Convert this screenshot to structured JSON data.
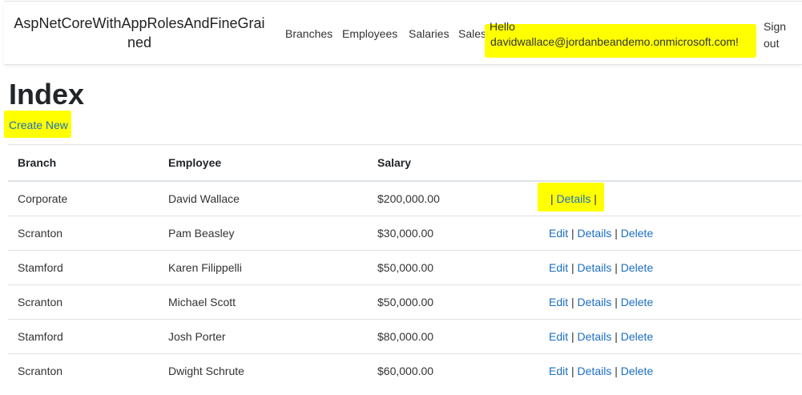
{
  "brand": "AspNetCoreWithAppRolesAndFineGrained",
  "nav": {
    "branches": "Branches",
    "employees": "Employees",
    "salaries": "Salaries",
    "sales": "Sales"
  },
  "user": {
    "hello": "Hello",
    "email": "davidwallace@jordanbeandemo.onmicrosoft.com!",
    "sign_out": "Sign out"
  },
  "page": {
    "title": "Index",
    "create_new": "Create New"
  },
  "table": {
    "headers": [
      "Branch",
      "Employee",
      "Salary"
    ],
    "rows": [
      {
        "branch": "Corporate",
        "employee": "David Wallace",
        "salary": "$200,000.00",
        "actions": "details-only"
      },
      {
        "branch": "Scranton",
        "employee": "Pam Beasley",
        "salary": "$30,000.00",
        "actions": "full"
      },
      {
        "branch": "Stamford",
        "employee": "Karen Filippelli",
        "salary": "$50,000.00",
        "actions": "full"
      },
      {
        "branch": "Scranton",
        "employee": "Michael Scott",
        "salary": "$50,000.00",
        "actions": "full"
      },
      {
        "branch": "Stamford",
        "employee": "Josh Porter",
        "salary": "$80,000.00",
        "actions": "full"
      },
      {
        "branch": "Scranton",
        "employee": "Dwight Schrute",
        "salary": "$60,000.00",
        "actions": "full"
      }
    ],
    "action_labels": {
      "edit": "Edit",
      "details": "Details",
      "delete": "Delete",
      "separator": "|"
    }
  },
  "colors": {
    "link": "#1b6ec2",
    "highlight": "#ffff00",
    "text": "#212529"
  }
}
